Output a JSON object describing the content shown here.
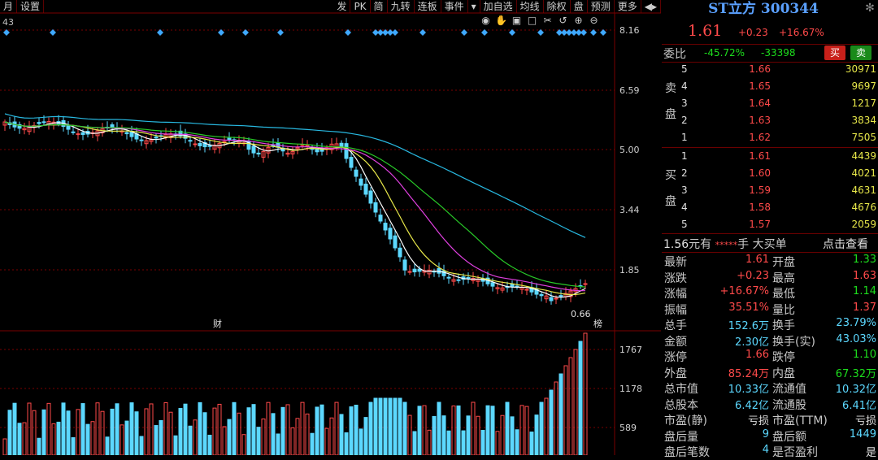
{
  "toolbar": {
    "left_items": [
      "月",
      "设置"
    ],
    "right_items": [
      "发",
      "PK",
      "简",
      "九转",
      "连板",
      "事件",
      "▾",
      "加自选",
      "均线",
      "除权",
      "盘",
      "预测",
      "更多",
      "◀▸"
    ],
    "tool_icons": [
      "eye-icon",
      "hand-icon",
      "lock-icon",
      "square-icon",
      "scissors-icon",
      "undo-icon",
      "zoom-in-icon",
      "zoom-out-icon"
    ]
  },
  "chart": {
    "top_left_value": "43",
    "price_ticks": [
      "8.16",
      "6.59",
      "5.00",
      "3.44",
      "1.85"
    ],
    "min_label": "0.66",
    "event_markers": [
      "财",
      "榜"
    ],
    "volume_ticks": [
      "1767",
      "1178",
      "589"
    ],
    "colors": {
      "up": "#ff4a4a",
      "down": "#5cd8ff",
      "ma5": "#ffffff",
      "ma10": "#e8e84a",
      "ma20": "#e040e0",
      "ma30": "#28c828",
      "ma60": "#28b8e0",
      "grid": "#7a0000",
      "diamond": "#3fa8ff"
    }
  },
  "chart_data": {
    "type": "candlestick",
    "price_axis": {
      "ticks": [
        8.16,
        6.59,
        5.0,
        3.44,
        1.85
      ]
    },
    "volume_axis": {
      "ticks": [
        1767,
        1178,
        589
      ]
    },
    "annotations": [
      "0.66"
    ]
  },
  "quote": {
    "title": "ST立方 300344",
    "price": "1.61",
    "change": "+0.23",
    "change_pct": "+16.67%",
    "weibi_label": "委比",
    "weibi_pct": "-45.72%",
    "weibi_diff": "-33398",
    "sell_button": "买",
    "buy_button": "卖",
    "sell_side_label": [
      "卖",
      "盘"
    ],
    "buy_side_label": [
      "买",
      "盘"
    ],
    "asks": [
      {
        "level": "5",
        "price": "1.66",
        "vol": "30971"
      },
      {
        "level": "4",
        "price": "1.65",
        "vol": "9697"
      },
      {
        "level": "3",
        "price": "1.64",
        "vol": "1217"
      },
      {
        "level": "2",
        "price": "1.63",
        "vol": "3834"
      },
      {
        "level": "1",
        "price": "1.62",
        "vol": "7505"
      }
    ],
    "bids": [
      {
        "level": "1",
        "price": "1.61",
        "vol": "4439"
      },
      {
        "level": "2",
        "price": "1.60",
        "vol": "4021"
      },
      {
        "level": "3",
        "price": "1.59",
        "vol": "4631"
      },
      {
        "level": "4",
        "price": "1.58",
        "vol": "4676"
      },
      {
        "level": "5",
        "price": "1.57",
        "vol": "2059"
      }
    ],
    "big_order": {
      "price": "1.56",
      "unit_a": "元有",
      "stars": "*****",
      "unit_b": "手",
      "text": "大买单",
      "link": "点击查看"
    },
    "stats": [
      {
        "k1": "最新",
        "v1": "1.61",
        "c1": "red",
        "k2": "开盘",
        "v2": "1.33",
        "c2": "grn"
      },
      {
        "k1": "涨跌",
        "v1": "+0.23",
        "c1": "red",
        "k2": "最高",
        "v2": "1.63",
        "c2": "red"
      },
      {
        "k1": "涨幅",
        "v1": "+16.67%",
        "c1": "red",
        "k2": "最低",
        "v2": "1.14",
        "c2": "grn"
      },
      {
        "k1": "振幅",
        "v1": "35.51%",
        "c1": "red",
        "k2": "量比",
        "v2": "1.37",
        "c2": "red"
      },
      {
        "k1": "总手",
        "v1": "152.6万",
        "c1": "cyan",
        "k2": "换手",
        "v2": "23.79%",
        "c2": "cyan"
      },
      {
        "k1": "金额",
        "v1": "2.30亿",
        "c1": "cyan",
        "k2": "换手(实)",
        "v2": "43.03%",
        "c2": "cyan"
      },
      {
        "k1": "涨停",
        "v1": "1.66",
        "c1": "red",
        "k2": "跌停",
        "v2": "1.10",
        "c2": "grn"
      },
      {
        "k1": "外盘",
        "v1": "85.24万",
        "c1": "red",
        "k2": "内盘",
        "v2": "67.32万",
        "c2": "grn"
      },
      {
        "k1": "总市值",
        "v1": "10.33亿",
        "c1": "cyan",
        "k2": "流通值",
        "v2": "10.32亿",
        "c2": "cyan"
      },
      {
        "k1": "总股本",
        "v1": "6.42亿",
        "c1": "cyan",
        "k2": "流通股",
        "v2": "6.41亿",
        "c2": "cyan"
      },
      {
        "k1": "市盈(静)",
        "v1": "亏损",
        "c1": "wht",
        "k2": "市盈(TTM)",
        "v2": "亏损",
        "c2": "wht"
      },
      {
        "k1": "盘后量",
        "v1": "9",
        "c1": "cyan",
        "k2": "盘后额",
        "v2": "1449",
        "c2": "cyan"
      },
      {
        "k1": "盘后笔数",
        "v1": "4",
        "c1": "cyan",
        "k2": "是否盈利",
        "v2": "是",
        "c2": "wht"
      }
    ]
  }
}
